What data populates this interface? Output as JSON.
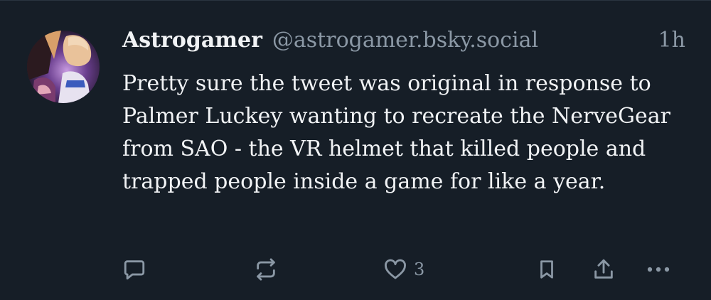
{
  "post": {
    "author": {
      "display_name": "Astrogamer",
      "handle": "@astrogamer.bsky.social"
    },
    "timestamp": "1h",
    "text": "Pretty sure the tweet was original in response to Palmer Luckey wanting to recreate the NerveGear from SAO - the VR helmet that killed people and trapped people inside a game for like a year.",
    "actions": {
      "reply_icon": "speech-bubble-icon",
      "repost_icon": "repost-arrows-icon",
      "like_icon": "heart-icon",
      "like_count": "3",
      "bookmark_icon": "bookmark-icon",
      "share_icon": "share-icon",
      "more_icon": "ellipsis-icon"
    }
  },
  "colors": {
    "background": "#161e27",
    "text_primary": "#f1f3f5",
    "text_secondary": "#8b98a5"
  }
}
